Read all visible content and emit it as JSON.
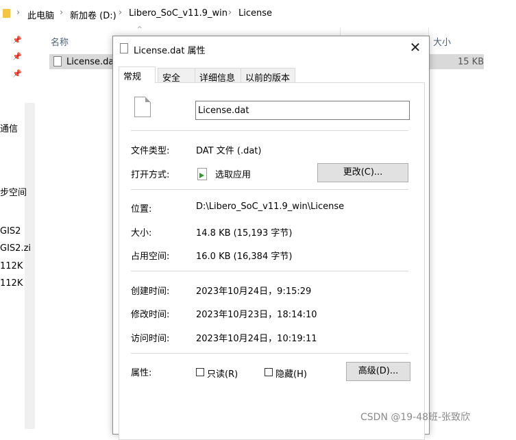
{
  "explorer": {
    "breadcrumb": [
      "此电脑",
      "新加卷 (D:)",
      "Libero_SoC_v11.9_win",
      "License"
    ],
    "columns": {
      "name": "名称",
      "size": "大小"
    },
    "left_items": [
      "通信",
      "步空间",
      "GIS2",
      "GIS2.zi",
      "112K",
      "112K"
    ],
    "file": {
      "name": "License.dat",
      "size": "15 KB"
    }
  },
  "dialog": {
    "title": "License.dat 属性",
    "close_glyph": "✕",
    "tabs": [
      "常规",
      "安全",
      "详细信息",
      "以前的版本"
    ],
    "active_tab": 0,
    "filename": "License.dat",
    "file_type": {
      "label": "文件类型:",
      "value": "DAT 文件 (.dat)"
    },
    "opens_with": {
      "label": "打开方式:",
      "value": "选取应用",
      "button": "更改(C)..."
    },
    "location": {
      "label": "位置:",
      "value": "D:\\Libero_SoC_v11.9_win\\License"
    },
    "size": {
      "label": "大小:",
      "value": "14.8 KB (15,193 字节)"
    },
    "size_on_disk": {
      "label": "占用空间:",
      "value": "16.0 KB (16,384 字节)"
    },
    "created": {
      "label": "创建时间:",
      "value": "2023年10月24日，9:15:29"
    },
    "modified": {
      "label": "修改时间:",
      "value": "2023年10月23日，18:14:10"
    },
    "accessed": {
      "label": "访问时间:",
      "value": "2023年10月24日，10:19:11"
    },
    "attributes": {
      "label": "属性:",
      "readonly": "只读(R)",
      "readonly_checked": false,
      "hidden": "隐藏(H)",
      "hidden_checked": false,
      "advanced_button": "高级(D)..."
    }
  },
  "watermark": "CSDN @19-48班-张致欣"
}
